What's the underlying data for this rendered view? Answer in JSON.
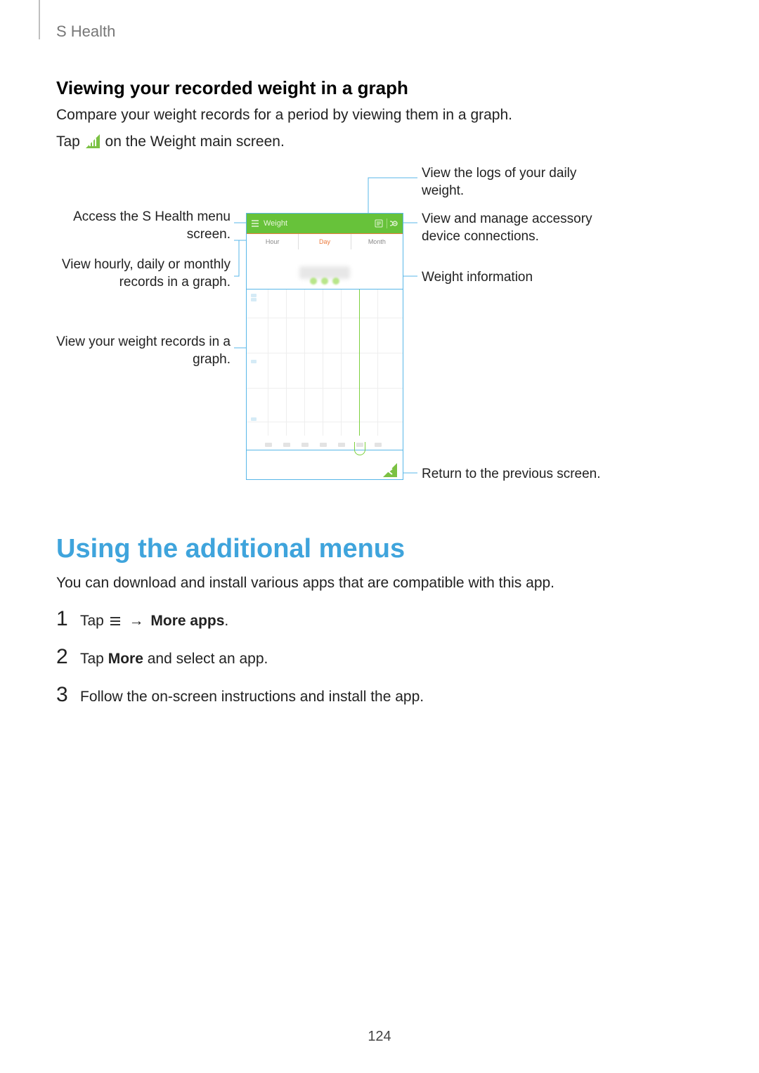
{
  "header": {
    "app_name": "S Health"
  },
  "section1": {
    "heading": "Viewing your recorded weight in a graph",
    "line1": "Compare your weight records for a period by viewing them in a graph.",
    "tap_prefix": "Tap ",
    "tap_suffix": " on the Weight main screen."
  },
  "phone": {
    "title": "Weight",
    "tabs": {
      "hour": "Hour",
      "day": "Day",
      "month": "Month",
      "active": "Day"
    }
  },
  "callouts": {
    "menu": "Access the S Health menu screen.",
    "tabs": "View hourly, daily or monthly records in a graph.",
    "graph": "View your weight records in a graph.",
    "logs": "View the logs of your daily weight.",
    "conn": "View and manage accessory device connections.",
    "info": "Weight information",
    "return": "Return to the previous screen."
  },
  "section2": {
    "heading": "Using the additional menus",
    "intro": "You can download and install various apps that are compatible with this app.",
    "steps": {
      "s1_num": "1",
      "s1_tap": "Tap ",
      "s1_arrow": "→",
      "s1_link": "More apps",
      "s1_period": ".",
      "s2_num": "2",
      "s2_pre": "Tap ",
      "s2_bold": "More",
      "s2_post": " and select an app.",
      "s3_num": "3",
      "s3_text": "Follow the on-screen instructions and install the app."
    }
  },
  "page_number": "124",
  "chart_data": {
    "type": "bar",
    "note": "Illustrative UI mock of a weight-by-day bar chart; axis values and bar heights are blurred/unlabeled in the source and not readable.",
    "categories": [
      "d1",
      "d2",
      "d3",
      "d4",
      "d5",
      "d6",
      "d7"
    ],
    "values": [
      null,
      null,
      null,
      null,
      null,
      null,
      null
    ],
    "highlighted_index": 5,
    "tabs": [
      "Hour",
      "Day",
      "Month"
    ],
    "active_tab": "Day",
    "title": "Weight",
    "xlabel": "",
    "ylabel": ""
  }
}
